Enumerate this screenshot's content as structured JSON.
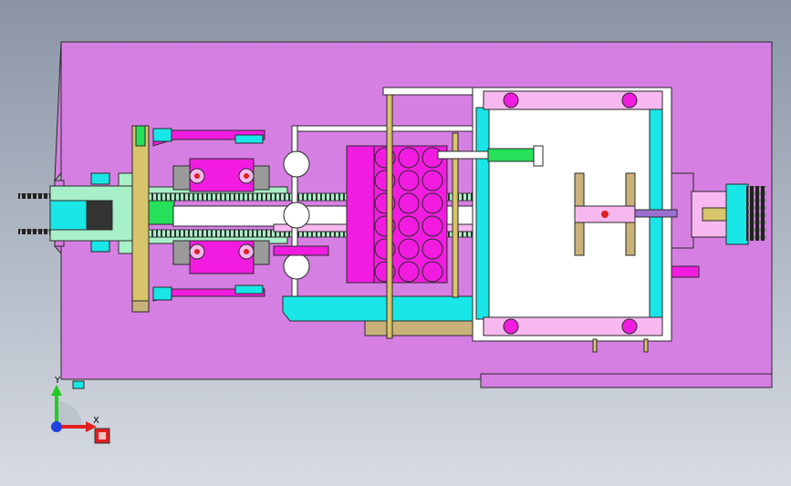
{
  "colors": {
    "background_top": "#8a94a6",
    "background_bottom": "#d7dbe3",
    "base_plate": "#d57fe3",
    "outline": "#2a2a2a",
    "cyan": "#19e6e6",
    "magenta": "#f21ce0",
    "pink": "#f7b8ef",
    "white": "#ffffff",
    "mint": "#a8f0c8",
    "green": "#27e05a",
    "yellow_wood": "#d8c46a",
    "khaki": "#c9b27a",
    "purple": "#9b6fd0",
    "red": "#e02020",
    "gray": "#9a9a9a",
    "dark": "#333333"
  },
  "triad": {
    "x_label": "X",
    "y_label": "Y",
    "x_color": "#e02020",
    "y_color": "#22cc22",
    "z_color": "#2040e0"
  },
  "icons": {
    "triad": "coordinate-triad-icon",
    "view_cube": "view-cube-icon"
  }
}
